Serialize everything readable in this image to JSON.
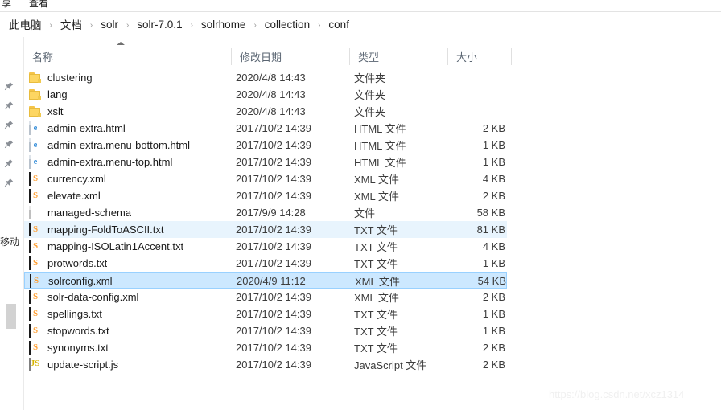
{
  "window": {
    "menu_items": [
      "享",
      "查看"
    ]
  },
  "breadcrumb": {
    "separator": "›",
    "items": [
      "此电脑",
      "文档",
      "solr",
      "solr-7.0.1",
      "solrhome",
      "collection",
      "conf"
    ]
  },
  "nav_pane": {
    "pins": [
      "pin-icon",
      "pin-icon",
      "pin-icon",
      "pin-icon",
      "pin-icon",
      "pin-icon"
    ],
    "clipped_label": "移动"
  },
  "columns": [
    {
      "key": "name",
      "label": "名称",
      "sorted": "ascending"
    },
    {
      "key": "date",
      "label": "修改日期",
      "sorted": ""
    },
    {
      "key": "type",
      "label": "类型",
      "sorted": ""
    },
    {
      "key": "size",
      "label": "大小",
      "sorted": ""
    }
  ],
  "files": [
    {
      "name": "clustering",
      "date": "2020/4/8 14:43",
      "type": "文件夹",
      "size": "",
      "icon": "folder",
      "state": ""
    },
    {
      "name": "lang",
      "date": "2020/4/8 14:43",
      "type": "文件夹",
      "size": "",
      "icon": "folder",
      "state": ""
    },
    {
      "name": "xslt",
      "date": "2020/4/8 14:43",
      "type": "文件夹",
      "size": "",
      "icon": "folder",
      "state": ""
    },
    {
      "name": "admin-extra.html",
      "date": "2017/10/2 14:39",
      "type": "HTML 文件",
      "size": "2 KB",
      "icon": "html",
      "state": ""
    },
    {
      "name": "admin-extra.menu-bottom.html",
      "date": "2017/10/2 14:39",
      "type": "HTML 文件",
      "size": "1 KB",
      "icon": "html",
      "state": ""
    },
    {
      "name": "admin-extra.menu-top.html",
      "date": "2017/10/2 14:39",
      "type": "HTML 文件",
      "size": "1 KB",
      "icon": "html",
      "state": ""
    },
    {
      "name": "currency.xml",
      "date": "2017/10/2 14:39",
      "type": "XML 文件",
      "size": "4 KB",
      "icon": "sublime",
      "state": ""
    },
    {
      "name": "elevate.xml",
      "date": "2017/10/2 14:39",
      "type": "XML 文件",
      "size": "2 KB",
      "icon": "sublime",
      "state": ""
    },
    {
      "name": "managed-schema",
      "date": "2017/9/9 14:28",
      "type": "文件",
      "size": "58 KB",
      "icon": "plain",
      "state": ""
    },
    {
      "name": "mapping-FoldToASCII.txt",
      "date": "2017/10/2 14:39",
      "type": "TXT 文件",
      "size": "81 KB",
      "icon": "sublime",
      "state": "hover"
    },
    {
      "name": "mapping-ISOLatin1Accent.txt",
      "date": "2017/10/2 14:39",
      "type": "TXT 文件",
      "size": "4 KB",
      "icon": "sublime",
      "state": ""
    },
    {
      "name": "protwords.txt",
      "date": "2017/10/2 14:39",
      "type": "TXT 文件",
      "size": "1 KB",
      "icon": "sublime",
      "state": ""
    },
    {
      "name": "solrconfig.xml",
      "date": "2020/4/9 11:12",
      "type": "XML 文件",
      "size": "54 KB",
      "icon": "sublime",
      "state": "selected"
    },
    {
      "name": "solr-data-config.xml",
      "date": "2017/10/2 14:39",
      "type": "XML 文件",
      "size": "2 KB",
      "icon": "sublime",
      "state": ""
    },
    {
      "name": "spellings.txt",
      "date": "2017/10/2 14:39",
      "type": "TXT 文件",
      "size": "1 KB",
      "icon": "sublime",
      "state": ""
    },
    {
      "name": "stopwords.txt",
      "date": "2017/10/2 14:39",
      "type": "TXT 文件",
      "size": "1 KB",
      "icon": "sublime",
      "state": ""
    },
    {
      "name": "synonyms.txt",
      "date": "2017/10/2 14:39",
      "type": "TXT 文件",
      "size": "2 KB",
      "icon": "sublime",
      "state": ""
    },
    {
      "name": "update-script.js",
      "date": "2017/10/2 14:39",
      "type": "JavaScript 文件",
      "size": "2 KB",
      "icon": "js",
      "state": ""
    }
  ],
  "watermark": {
    "text": "https://blog.csdn.net/xcz1314"
  },
  "colors": {
    "selection_fill": "#cce8ff",
    "selection_border": "#99d1ff",
    "hover_fill": "#e8f4fd",
    "header_text": "#5a6572",
    "folder_yellow": "#fdd662"
  }
}
